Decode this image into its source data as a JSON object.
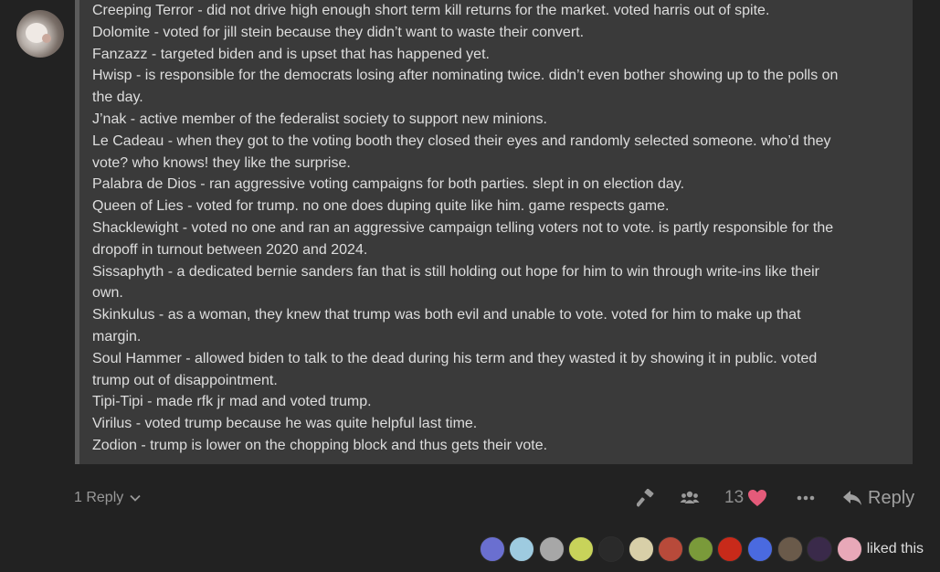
{
  "post": {
    "lines": [
      "Creeping Terror - did not drive high enough short term kill returns for the market. voted harris out of spite.",
      "Dolomite - voted for jill stein because they didn’t want to waste their convert.",
      "Fanzazz - targeted biden and is upset that has happened yet.",
      "Hwisp - is responsible for the democrats losing after nominating twice. didn’t even bother showing up to the polls on",
      "the day.",
      "J’nak - active member of the federalist society to support new minions.",
      "Le Cadeau - when they got to the voting booth they closed their eyes and randomly selected someone. who’d they",
      "vote? who knows! they like the surprise.",
      "Palabra de Dios - ran aggressive voting campaigns for both parties. slept in on election day.",
      "Queen of Lies - voted for trump. no one does duping quite like him. game respects game.",
      "Shacklewight - voted no one and ran an aggressive campaign telling voters not to vote. is partly responsible for the",
      "dropoff in turnout between 2020 and 2024.",
      "Sissaphyth - a dedicated bernie sanders fan that is still holding out hope for him to win through write-ins like their",
      "own.",
      "Skinkulus - as a woman, they knew that trump was both evil and unable to vote. voted for him to make up that",
      "margin.",
      "Soul Hammer - allowed biden to talk to the dead during his term and they wasted it by showing it in public. voted",
      "trump out of disappointment.",
      "Tipi-Tipi - made rfk jr mad and voted trump.",
      "Virilus - voted trump because he was quite helpful last time.",
      "Zodion - trump is lower on the chopping block and thus gets their vote."
    ]
  },
  "actions": {
    "replies_label": "1 Reply",
    "like_count": "13",
    "reply_label": "Reply"
  },
  "likers": {
    "label": "liked this",
    "avatar_colors": [
      "#6a6fd0",
      "#9ecbe0",
      "#a7a7a7",
      "#c8d35a",
      "#2a2a2a",
      "#d8cfa8",
      "#b84a3a",
      "#7a9a3a",
      "#c82a1a",
      "#4a6ae0",
      "#6a5a4a",
      "#3a2a4a",
      "#e8a8b8"
    ]
  },
  "colors": {
    "background": "#222222",
    "quote_background": "#3a3a3a",
    "quote_border": "#5c5c5c",
    "heart": "#e45b7a",
    "muted": "#999999"
  }
}
